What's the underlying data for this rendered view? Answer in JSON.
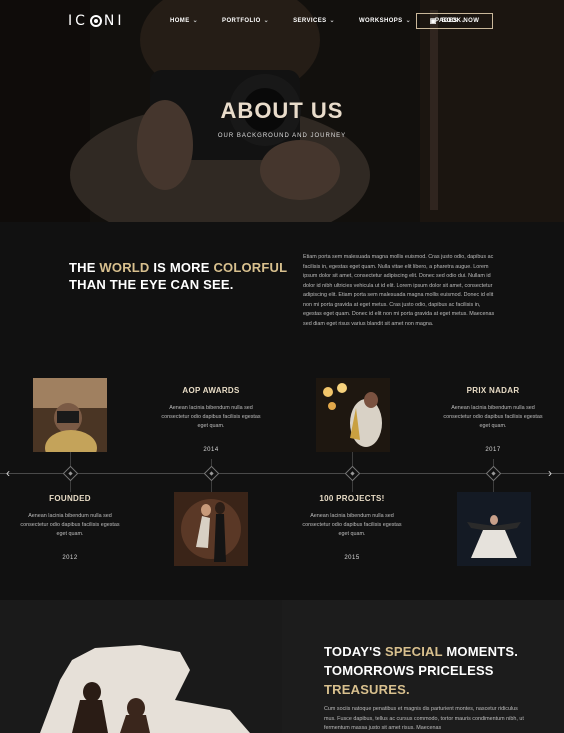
{
  "nav": {
    "logo": "ICONI",
    "items": [
      {
        "label": "HOME"
      },
      {
        "label": "PORTFOLIO"
      },
      {
        "label": "SERVICES"
      },
      {
        "label": "WORKSHOPS"
      },
      {
        "label": "PAGES"
      }
    ],
    "book_label": "BOOK NOW"
  },
  "hero": {
    "title": "ABOUT US",
    "subtitle": "OUR BACKGROUND AND JOURNEY"
  },
  "intro": {
    "head_1": "THE ",
    "head_accent_1": "WORLD",
    "head_2": " IS MORE ",
    "head_accent_2": "COLORFUL",
    "head_3": " THAN THE EYE CAN SEE.",
    "body": "Etiam porta sem malesuada magna mollis euismod. Cras justo odio, dapibus ac facilisis in, egestas eget quam. Nulla vitae elit libero, a pharetra augue. Lorem ipsum dolor sit amet, consectetur adipiscing elit. Donec sed odio dui. Nullam id dolor id nibh ultricies vehicula ut id elit. Lorem ipsum dolor sit amet, consectetur adipiscing elit. Etiam porta sem malesuada magna mollis euismod. Donec id elit non mi porta gravida at eget metus. Cras justo odio, dapibus ac facilisis in, egestas eget quam. Donec id elit non mi porta gravida at eget metus. Maecenas sed diam eget risus varius blandit sit amet non magna."
  },
  "timeline": {
    "top": [
      {
        "title": "AOP AWARDS",
        "text": "Aenean lacinia bibendum nulla sed consectetur odio dapibus facilisis egestas eget quam.",
        "year": "2014"
      },
      {
        "title": "PRIX NADAR",
        "text": "Aenean lacinia bibendum nulla sed consectetur odio dapibus facilisis egestas eget quam.",
        "year": "2017"
      }
    ],
    "bottom": [
      {
        "title": "FOUNDED",
        "text": "Aenean lacinia bibendum nulla sed consectetur odio dapibus facilisis egestas eget quam.",
        "year": "2012"
      },
      {
        "title": "100 PROJECTS!",
        "text": "Aenean lacinia bibendum nulla sed consectetur odio dapibus facilisis egestas eget quam.",
        "year": "2015"
      }
    ],
    "prev_icon": "chevron-left-icon",
    "next_icon": "chevron-right-icon"
  },
  "moments": {
    "line1_a": "TODAY'S ",
    "line1_accent": "SPECIAL",
    "line1_b": " MOMENTS.",
    "line2": "TOMORROWS PRICELESS",
    "line3_accent": "TREASURES.",
    "body": "Cum sociis natoque penatibus et magnis dis parturient montes, nascetur ridiculus mus. Fusce dapibus, tellus ac cursus commodo, tortor mauris condimentum nibh, ut fermentum massa justo sit amet risus. Maecenas"
  },
  "colors": {
    "accent": "#d8c08e",
    "background": "#111111"
  }
}
